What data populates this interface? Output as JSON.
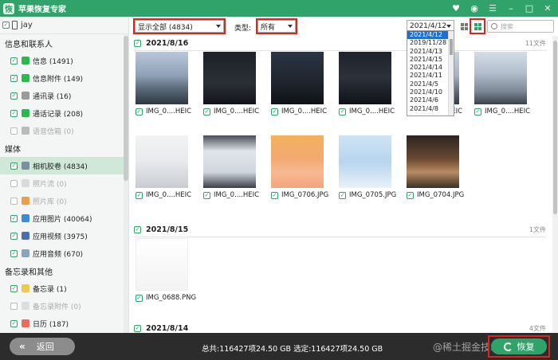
{
  "app": {
    "title": "苹果恢复专家",
    "logo": "恢"
  },
  "titlebar_icons": [
    "heart-icon",
    "message-icon",
    "menu-icon",
    "minimize-icon",
    "maximize-icon",
    "close-icon"
  ],
  "sidebar": {
    "device": "jay",
    "sections": [
      {
        "title": "信息和联系人",
        "items": [
          {
            "label": "信息 (1491)",
            "checked": true,
            "icon": "message-icon",
            "color": "#2db84c"
          },
          {
            "label": "信息附件 (149)",
            "checked": true,
            "icon": "attachment-icon",
            "color": "#2db84c"
          },
          {
            "label": "通讯录 (16)",
            "checked": true,
            "icon": "contacts-icon",
            "color": "#9a9a9a"
          },
          {
            "label": "通话记录 (208)",
            "checked": true,
            "icon": "phone-icon",
            "color": "#2db84c"
          },
          {
            "label": "语音信箱 (0)",
            "checked": false,
            "icon": "voicemail-icon",
            "color": "#bbbbbb",
            "disabled": true
          }
        ]
      },
      {
        "title": "媒体",
        "items": [
          {
            "label": "相机胶卷 (4834)",
            "checked": true,
            "icon": "camera-icon",
            "color": "#7a8fa0",
            "selected": true
          },
          {
            "label": "照片流 (0)",
            "checked": false,
            "icon": "photostream-icon",
            "color": "#d9d9d9",
            "disabled": true
          },
          {
            "label": "照片库 (0)",
            "checked": false,
            "icon": "photo-library-icon",
            "color": "#e8a04a",
            "disabled": true
          },
          {
            "label": "应用图片 (40064)",
            "checked": true,
            "icon": "app-image-icon",
            "color": "#3a8bd6"
          },
          {
            "label": "应用视频 (3975)",
            "checked": true,
            "icon": "app-video-icon",
            "color": "#4a6fb0"
          },
          {
            "label": "应用音频 (670)",
            "checked": true,
            "icon": "app-audio-icon",
            "color": "#8aa3c0"
          }
        ]
      },
      {
        "title": "备忘录和其他",
        "items": [
          {
            "label": "备忘录 (1)",
            "checked": true,
            "icon": "notes-icon",
            "color": "#f2c94c"
          },
          {
            "label": "备忘录附件 (0)",
            "checked": false,
            "icon": "notes-attachment-icon",
            "color": "#dddddd",
            "disabled": true
          },
          {
            "label": "日历 (187)",
            "checked": true,
            "icon": "calendar-icon",
            "color": "#e86d5a"
          },
          {
            "label": "提醒事项 (0)",
            "checked": false,
            "icon": "reminders-icon",
            "color": "#dddddd",
            "disabled": true
          }
        ]
      }
    ]
  },
  "toolbar": {
    "show_filter": "显示全部 (4834)",
    "type_label": "类型:",
    "type_value": "所有",
    "date_value": "2021/4/12",
    "search_placeholder": "搜索"
  },
  "date_options": [
    "2021/4/12",
    "2019/11/28",
    "2021/4/13",
    "2021/4/15",
    "2021/4/14",
    "2021/4/11",
    "2021/4/5",
    "2021/4/10",
    "2021/4/6",
    "2021/4/8"
  ],
  "groups": [
    {
      "date": "2021/8/16",
      "count": "11文件",
      "photos": [
        {
          "name": "IMG_0....HEIC"
        },
        {
          "name": "IMG_0....HEIC"
        },
        {
          "name": "IMG_0....HEIC"
        },
        {
          "name": "IMG_0....HEIC"
        },
        {
          "name": "IMG_0....HEIC"
        },
        {
          "name": "IMG_0....HEIC"
        },
        {
          "name": "IMG_0....HEIC"
        },
        {
          "name": "IMG_0....HEIC"
        },
        {
          "name": "IMG_0706.JPG"
        },
        {
          "name": "IMG_0705.JPG"
        },
        {
          "name": "IMG_0704.JPG"
        }
      ]
    },
    {
      "date": "2021/8/15",
      "count": "1文件",
      "photos": [
        {
          "name": "IMG_0688.PNG"
        }
      ]
    },
    {
      "date": "2021/8/14",
      "count": "4文件",
      "photos": []
    }
  ],
  "footer": {
    "back_label": "返回",
    "status": "总共:116427项24.50 GB 选定:116427项24.50 GB",
    "recover_label": "恢复",
    "watermark": "@稀土掘金技术社区"
  }
}
